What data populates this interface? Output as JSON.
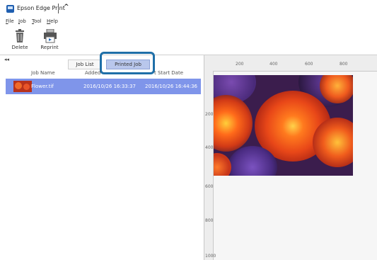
{
  "window": {
    "title": "Epson Edge Print",
    "collapse_glyph": "^"
  },
  "menu": [
    "File",
    "Job",
    "Tool",
    "Help"
  ],
  "toolbar": {
    "delete_label": "Delete",
    "reprint_label": "Reprint"
  },
  "tabs": {
    "job_list": "Job List",
    "printed_job": "Printed Job",
    "active": "Printed Job"
  },
  "table": {
    "collapse_glyph": "◂◂",
    "headers": {
      "job_name": "Job Name",
      "added": "Added",
      "start_date": "t Start Date"
    },
    "rows": [
      {
        "job_name": "Flower.tif",
        "added": "2016/10/26 16:33:37",
        "start_date": "2016/10/26 16:44:36"
      }
    ]
  },
  "ruler": {
    "top_ticks": [
      "200",
      "400",
      "600",
      "800"
    ],
    "left_ticks": [
      "200",
      "400",
      "600",
      "800",
      "1000"
    ]
  },
  "colors": {
    "accent": "#1f6fa8",
    "selected_row": "#7f95ea",
    "active_tab": "#b9c7ec"
  },
  "icons": {
    "delete": "trash-icon",
    "reprint": "printer-icon"
  }
}
